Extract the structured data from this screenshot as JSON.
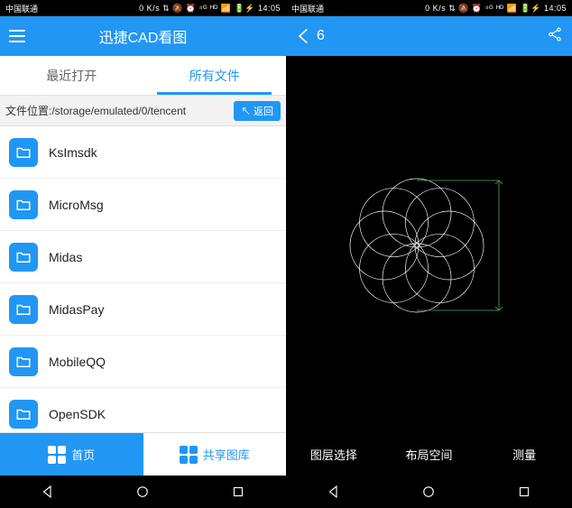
{
  "status": {
    "carrier": "中国联通",
    "right_glyphs": "0 K/s ⇅ 🔕 ⏰ ⁴ᴳ ᴴᴰ 📶 🔋⚡ 14:05"
  },
  "left": {
    "title": "迅捷CAD看图",
    "tabs": {
      "recent": "最近打开",
      "all": "所有文件"
    },
    "path_label": "文件位置:",
    "path": "/storage/emulated/0/tencent",
    "return_btn": "↖ 返回",
    "files": [
      "KsImsdk",
      "MicroMsg",
      "Midas",
      "MidasPay",
      "MobileQQ",
      "OpenSDK"
    ],
    "nav": {
      "home": "首页",
      "share_lib": "共享图库"
    }
  },
  "right": {
    "back_title": "6",
    "nav": {
      "layers": "图层选择",
      "layout": "布局空间",
      "measure": "测量"
    }
  }
}
